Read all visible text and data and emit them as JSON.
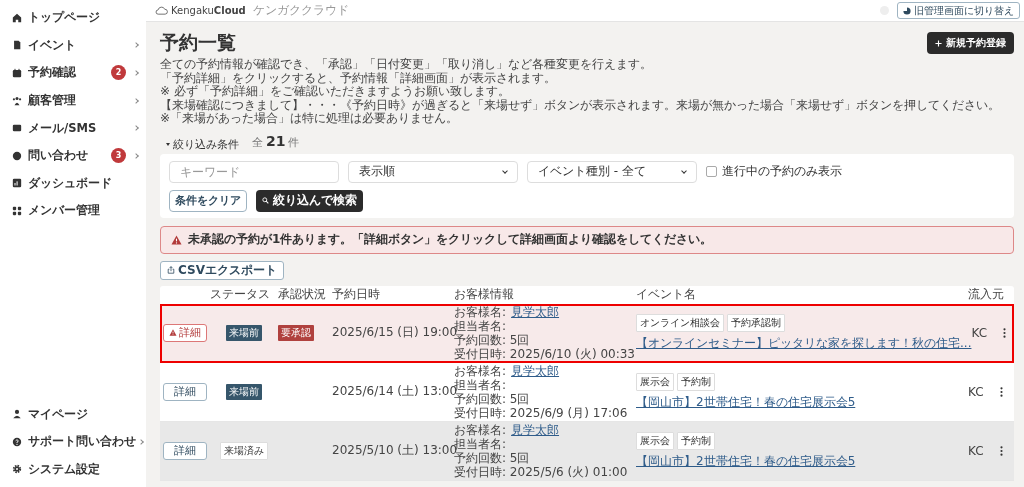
{
  "sidebar": {
    "items": [
      {
        "label": "トップページ",
        "submenu": false
      },
      {
        "label": "イベント",
        "submenu": true
      },
      {
        "label": "予約確認",
        "submenu": true,
        "badge": "2"
      },
      {
        "label": "顧客管理",
        "submenu": true
      },
      {
        "label": "メール/SMS",
        "submenu": true
      },
      {
        "label": "問い合わせ",
        "submenu": true,
        "badge": "3"
      },
      {
        "label": "ダッシュボード",
        "submenu": false
      },
      {
        "label": "メンバー管理",
        "submenu": false
      }
    ],
    "bottom_items": [
      {
        "label": "マイページ",
        "submenu": false
      },
      {
        "label": "サポート問い合わせ",
        "submenu": true
      },
      {
        "label": "システム設定",
        "submenu": false
      }
    ]
  },
  "header": {
    "logo": "Kengaku**Cloud**",
    "logo_sub": "ケンガククラウド",
    "switch_button": "旧管理画面に切り替え"
  },
  "page": {
    "title": "予約一覧",
    "new_button": "新規予約登録",
    "description": [
      "全ての予約情報が確認でき、「承認」「日付変更」「取り消し」など各種変更を行えます。",
      "「予約詳細」をクリックすると、予約情報「詳細画面」が表示されます。",
      "※ 必ず「予約詳細」をご確認いただきますようお願い致します。",
      "【来場確認につきまして】・・・《予約日時》が過ぎると「来場せず」ボタンが表示されます。来場が無かった場合「来場せず」ボタンを押してください。",
      "※「来場があった場合」は特に処理は必要ありません。"
    ]
  },
  "filter": {
    "toggle": "絞り込み条件",
    "expanded": true,
    "count_prefix": "全",
    "count": "21",
    "count_suffix": "件",
    "keyword": {
      "placeholder": "キーワード"
    },
    "sort": {
      "value": "表示順"
    },
    "event_type": {
      "value": "イベント種別 - 全て"
    },
    "ongoing_only": {
      "label": "進行中の予約のみ表示",
      "checked": false
    },
    "clear_button": "条件をクリア",
    "search_button": "絞り込んで検索"
  },
  "alert": "未承認の予約が1件あります。「詳細ボタン」をクリックして詳細画面より確認をしてください。",
  "csv_button": "CSVエクスポート",
  "table": {
    "columns": [
      "ステータス",
      "承認状況",
      "予約日時",
      "お客様情報",
      "イベント名",
      "流入元"
    ],
    "rows": [
      {
        "kind": "pending",
        "highlighted": true,
        "warning": true,
        "detail": "詳細",
        "status": {
          "label": "来場前",
          "kind": "before"
        },
        "approval": "要承認",
        "date": "2025/6/15 (日) 19:00",
        "customer_label": "お客様名:",
        "customer_name": "見学太郎",
        "staff": "担当者名:",
        "count": "予約回数: 5回",
        "received": "受付日時: 2025/6/10 (火) 00:33",
        "tags": [
          "オンライン相談会",
          "予約承認制"
        ],
        "event": "【オンラインセミナー】ピッタリな家を探します！秋の住宅...",
        "source": "KC"
      },
      {
        "kind": "normal",
        "highlighted": false,
        "warning": false,
        "detail": "詳細",
        "status": {
          "label": "来場前",
          "kind": "before"
        },
        "date": "2025/6/14 (土) 13:00",
        "customer_label": "お客様名:",
        "customer_name": "見学太郎",
        "staff": "担当者名:",
        "count": "予約回数: 5回",
        "received": "受付日時: 2025/6/9 (月) 17:06",
        "tags": [
          "展示会",
          "予約制"
        ],
        "event": "【岡山市】2世帯住宅！春の住宅展示会5",
        "source": "KC"
      },
      {
        "kind": "past",
        "highlighted": false,
        "warning": false,
        "detail": "詳細",
        "status": {
          "label": "来場済み",
          "kind": "done"
        },
        "date": "2025/5/10 (土) 13:00",
        "customer_label": "お客様名:",
        "customer_name": "見学太郎",
        "staff": "担当者名:",
        "count": "予約回数: 5回",
        "received": "受付日時: 2025/5/6 (火) 01:00",
        "tags": [
          "展示会",
          "予約制"
        ],
        "event": "【岡山市】2世帯住宅！春の住宅展示会5",
        "source": "KC"
      }
    ]
  }
}
